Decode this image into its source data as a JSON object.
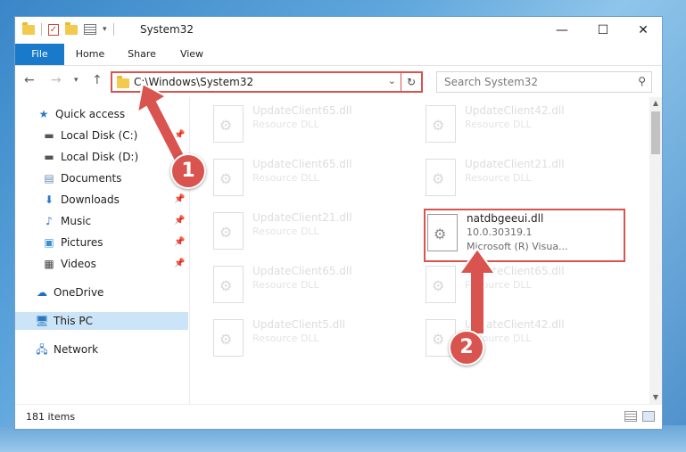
{
  "window": {
    "title": "System32",
    "minimize_glyph": "—",
    "maximize_glyph": "☐",
    "close_glyph": "✕"
  },
  "ribbon": {
    "tabs": [
      "File",
      "Home",
      "Share",
      "View"
    ]
  },
  "address_bar": {
    "path": "C:\\Windows\\System32",
    "search_placeholder": "Search System32"
  },
  "sidebar": {
    "items": [
      {
        "label": "Quick access",
        "icon": "star-icon"
      },
      {
        "label": "Local Disk (C:)",
        "icon": "drive-icon",
        "pinned": true
      },
      {
        "label": "Local Disk (D:)",
        "icon": "drive-icon"
      },
      {
        "label": "Documents",
        "icon": "documents-icon",
        "pinned": true
      },
      {
        "label": "Downloads",
        "icon": "download-icon",
        "pinned": true
      },
      {
        "label": "Music",
        "icon": "music-icon",
        "pinned": true
      },
      {
        "label": "Pictures",
        "icon": "pictures-icon",
        "pinned": true
      },
      {
        "label": "Videos",
        "icon": "videos-icon",
        "pinned": true
      },
      {
        "label": "OneDrive",
        "icon": "cloud-icon"
      },
      {
        "label": "This PC",
        "icon": "computer-icon",
        "selected": true
      },
      {
        "label": "Network",
        "icon": "network-icon"
      }
    ]
  },
  "files": [
    {
      "name": "UpdateClient65.dll",
      "type": "Resource DLL"
    },
    {
      "name": "UpdateClient42.dll",
      "type": "Resource DLL"
    },
    {
      "name": "UpdateClient65.dll",
      "type": "Resource DLL"
    },
    {
      "name": "UpdateClient21.dll",
      "type": "Resource DLL"
    },
    {
      "name": "UpdateClient21.dll",
      "type": "Resource DLL"
    },
    {
      "name": "natdbgeeui.dll",
      "version": "10.0.30319.1",
      "company": "Microsoft (R) Visua...",
      "highlighted": true
    },
    {
      "name": "UpdateClient65.dll",
      "type": "Resource DLL"
    },
    {
      "name": "UpdateClient65.dll",
      "type": "Resource DLL"
    },
    {
      "name": "UpdateClient5.dll",
      "type": "Resource DLL"
    },
    {
      "name": "UpdateClient42.dll",
      "type": "Resource DLL"
    }
  ],
  "status": {
    "item_count": "181 items"
  },
  "annotations": {
    "badge_1": "1",
    "badge_2": "2",
    "accent_color": "#d9534f"
  }
}
